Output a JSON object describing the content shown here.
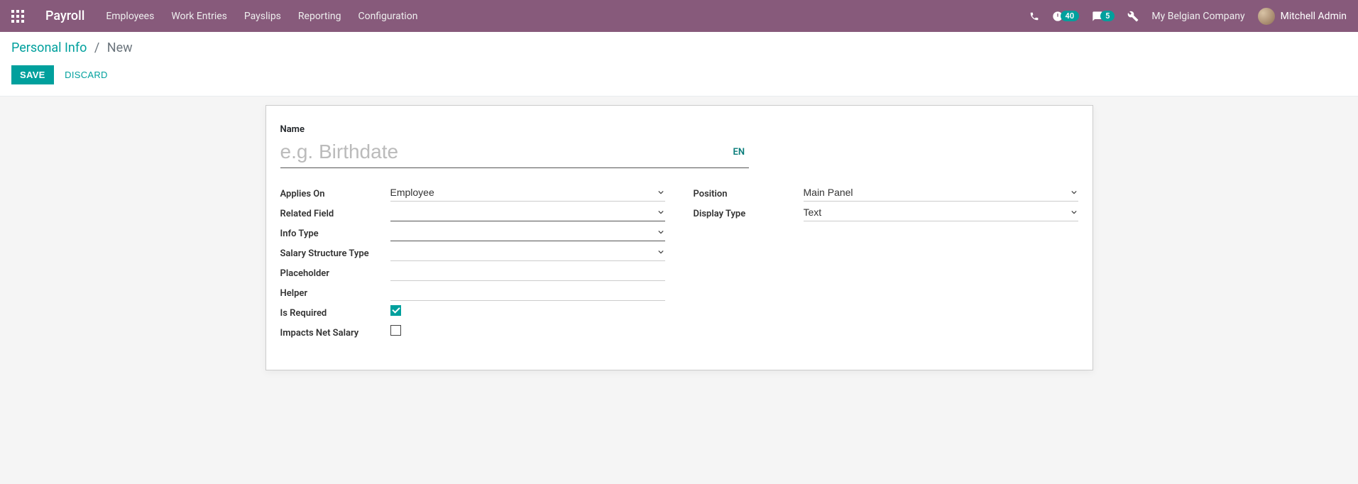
{
  "nav": {
    "brand": "Payroll",
    "menu": [
      "Employees",
      "Work Entries",
      "Payslips",
      "Reporting",
      "Configuration"
    ],
    "timer_badge": "40",
    "discuss_badge": "5",
    "company": "My Belgian Company",
    "user": "Mitchell Admin"
  },
  "breadcrumb": {
    "parent": "Personal Info",
    "current": "New"
  },
  "actions": {
    "save": "SAVE",
    "discard": "DISCARD"
  },
  "form": {
    "name_label": "Name",
    "name_placeholder": "e.g. Birthdate",
    "name_value": "",
    "lang": "EN",
    "left": {
      "applies_on": {
        "label": "Applies On",
        "value": "Employee"
      },
      "related_field": {
        "label": "Related Field",
        "value": ""
      },
      "info_type": {
        "label": "Info Type",
        "value": ""
      },
      "salary_struct": {
        "label": "Salary Structure Type",
        "value": ""
      },
      "placeholder": {
        "label": "Placeholder",
        "value": ""
      },
      "helper": {
        "label": "Helper",
        "value": ""
      },
      "is_required": {
        "label": "Is Required",
        "checked": true
      },
      "impacts_net": {
        "label": "Impacts Net Salary",
        "checked": false
      }
    },
    "right": {
      "position": {
        "label": "Position",
        "value": "Main Panel"
      },
      "display_type": {
        "label": "Display Type",
        "value": "Text"
      }
    }
  }
}
